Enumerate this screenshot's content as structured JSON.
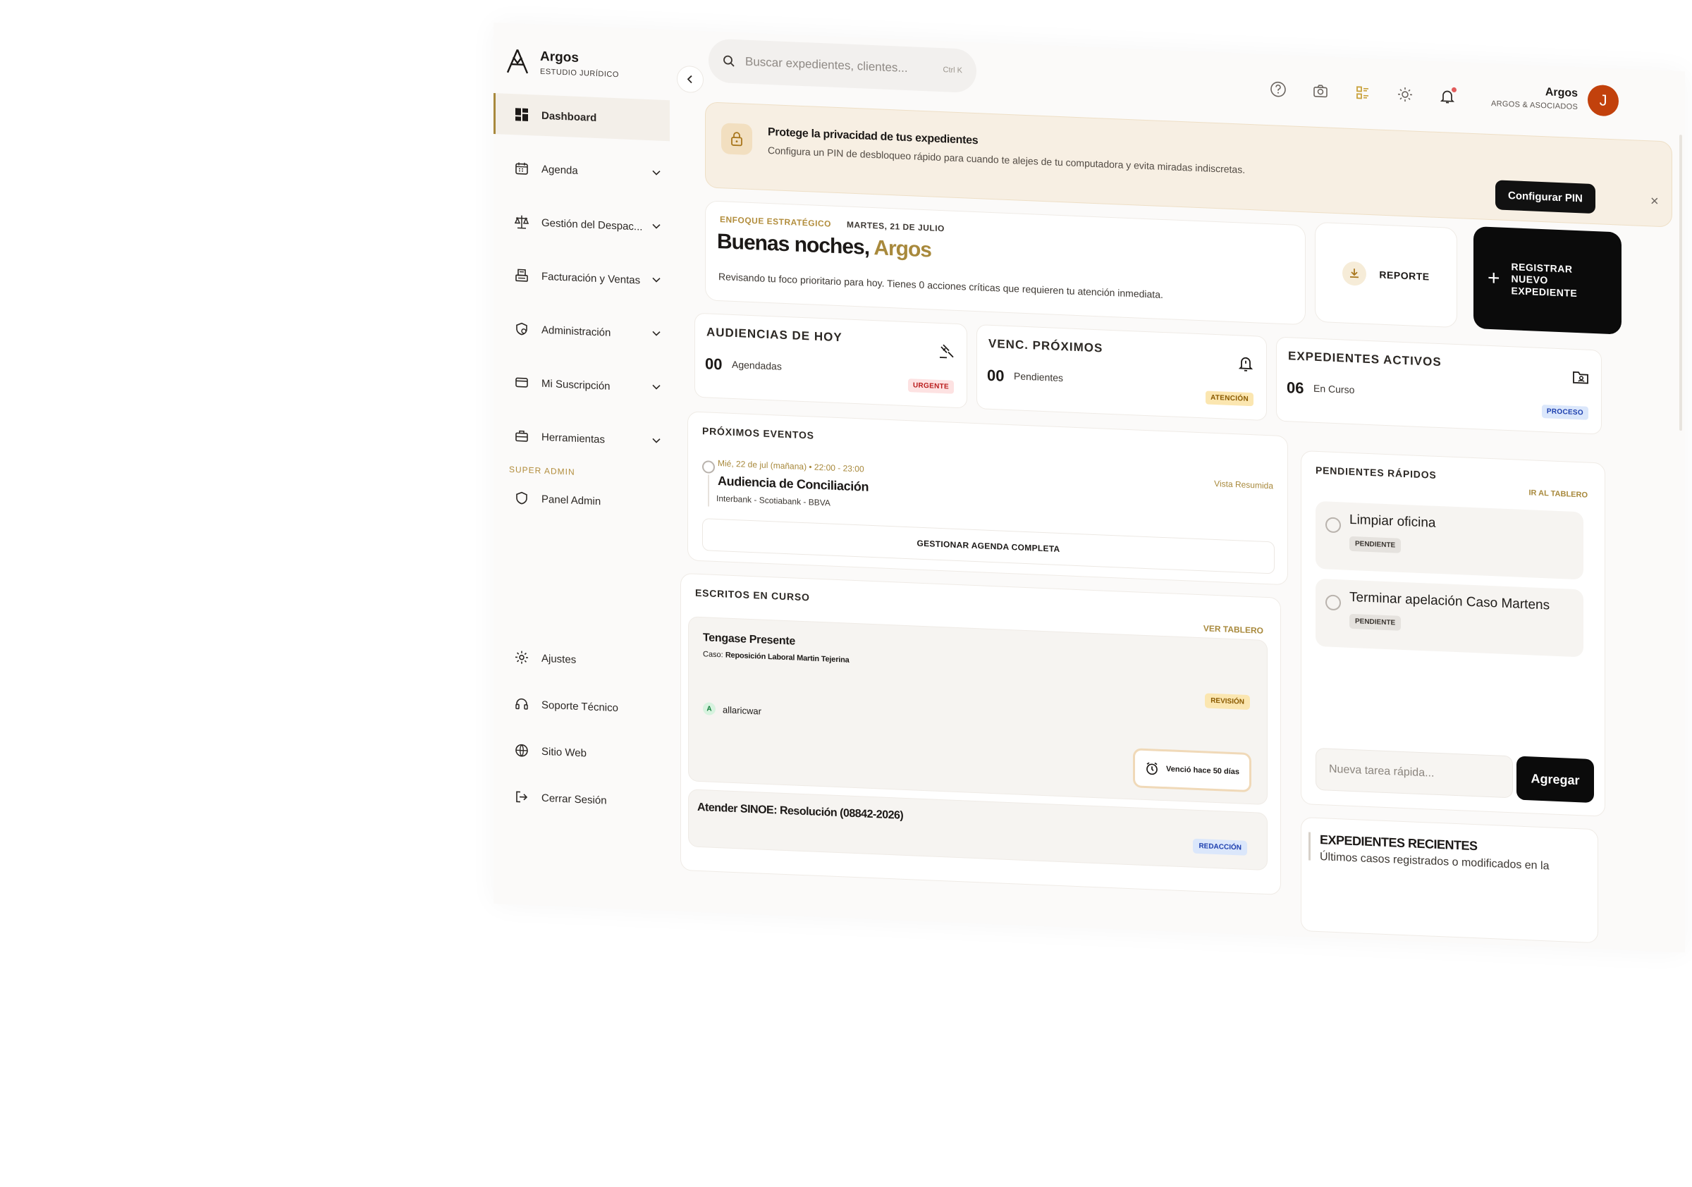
{
  "brand": {
    "name": "Argos",
    "subtitle": "ESTUDIO JURÍDICO"
  },
  "sidebar": {
    "items": [
      {
        "label": "Dashboard",
        "icon": "dashboard-icon",
        "active": true
      },
      {
        "label": "Agenda",
        "icon": "calendar-icon"
      },
      {
        "label": "Gestión del Despac...",
        "icon": "scales-icon"
      },
      {
        "label": "Facturación y Ventas",
        "icon": "register-icon"
      },
      {
        "label": "Administración",
        "icon": "shield-user-icon"
      },
      {
        "label": "Mi Suscripción",
        "icon": "card-icon"
      },
      {
        "label": "Herramientas",
        "icon": "toolbox-icon"
      }
    ],
    "section_label": "SUPER ADMIN",
    "admin_item": "Panel Admin",
    "bottom": [
      {
        "label": "Ajustes",
        "icon": "gear-icon"
      },
      {
        "label": "Soporte Técnico",
        "icon": "headset-icon"
      },
      {
        "label": "Sitio Web",
        "icon": "globe-icon"
      },
      {
        "label": "Cerrar Sesión",
        "icon": "logout-icon"
      }
    ]
  },
  "header": {
    "search_placeholder": "Buscar expedientes, clientes...",
    "search_shortcut": "Ctrl K",
    "user_name": "Argos",
    "user_org": "ARGOS & ASOCIADOS",
    "avatar_initial": "J",
    "icons": [
      "help-icon",
      "camera-icon",
      "list-icon",
      "sun-icon",
      "bell-icon"
    ]
  },
  "banner": {
    "title": "Protege la privacidad de tus expedientes",
    "desc": "Configura un PIN de desbloqueo rápido para cuando te alejes de tu computadora y evita miradas indiscretas.",
    "button": "Configurar PIN",
    "close": "×"
  },
  "greeting": {
    "tag": "ENFOQUE ESTRATÉGICO",
    "date": "MARTES, 21 DE JULIO",
    "hello": "Buenas noches,",
    "name": "Argos",
    "desc": "Revisando tu foco prioritario para hoy. Tienes 0 acciones críticas que requieren tu atención inmediata."
  },
  "actions": {
    "report": "REPORTE",
    "new_case": "REGISTRAR NUEVO EXPEDIENTE"
  },
  "stats": [
    {
      "title": "AUDIENCIAS DE HOY",
      "value": "00",
      "label": "Agendadas",
      "badge": "URGENTE",
      "badge_bg": "#fde2e2",
      "badge_fg": "#b91c1c"
    },
    {
      "title": "VENC. PRÓXIMOS",
      "value": "00",
      "label": "Pendientes",
      "badge": "ATENCIÓN",
      "badge_bg": "#fbe6b0",
      "badge_fg": "#8a5a00"
    },
    {
      "title": "EXPEDIENTES ACTIVOS",
      "value": "06",
      "label": "En Curso",
      "badge": "PROCESO",
      "badge_bg": "#dbe7fb",
      "badge_fg": "#1e40af"
    }
  ],
  "events": {
    "title": "PRÓXIMOS EVENTOS",
    "item": {
      "time": "Mié, 22 de jul (mañana) • 22:00 - 23:00",
      "view": "Vista Resumida",
      "name": "Audiencia de Conciliación",
      "sub": "Interbank - Scotiabank - BBVA"
    },
    "manage": "GESTIONAR AGENDA COMPLETA"
  },
  "escritos": {
    "title": "ESCRITOS EN CURSO",
    "view": "VER TABLERO",
    "item1": {
      "title": "Tengase Presente",
      "case_prefix": "Caso:",
      "case": "Reposición Laboral Martin Tejerina",
      "badge": "REVISIÓN",
      "user_initial": "A",
      "user": "allaricwar",
      "due": "Venció hace 50 días"
    },
    "item2": {
      "title": "Atender SINOE: Resolución (08842-2026)",
      "badge": "REDACCIÓN"
    }
  },
  "pendientes": {
    "title": "PENDIENTES RÁPIDOS",
    "link": "IR AL TABLERO",
    "tasks": [
      {
        "name": "Limpiar oficina",
        "status": "PENDIENTE"
      },
      {
        "name": "Terminar apelación Caso Martens",
        "status": "PENDIENTE"
      }
    ],
    "input_placeholder": "Nueva tarea rápida...",
    "add": "Agregar"
  },
  "recent": {
    "title": "EXPEDIENTES RECIENTES",
    "desc": "Últimos casos registrados o modificados en la"
  },
  "colors": {
    "accent": "#a8893c",
    "dark": "#0b0b0b",
    "avatar": "#c2410c"
  }
}
